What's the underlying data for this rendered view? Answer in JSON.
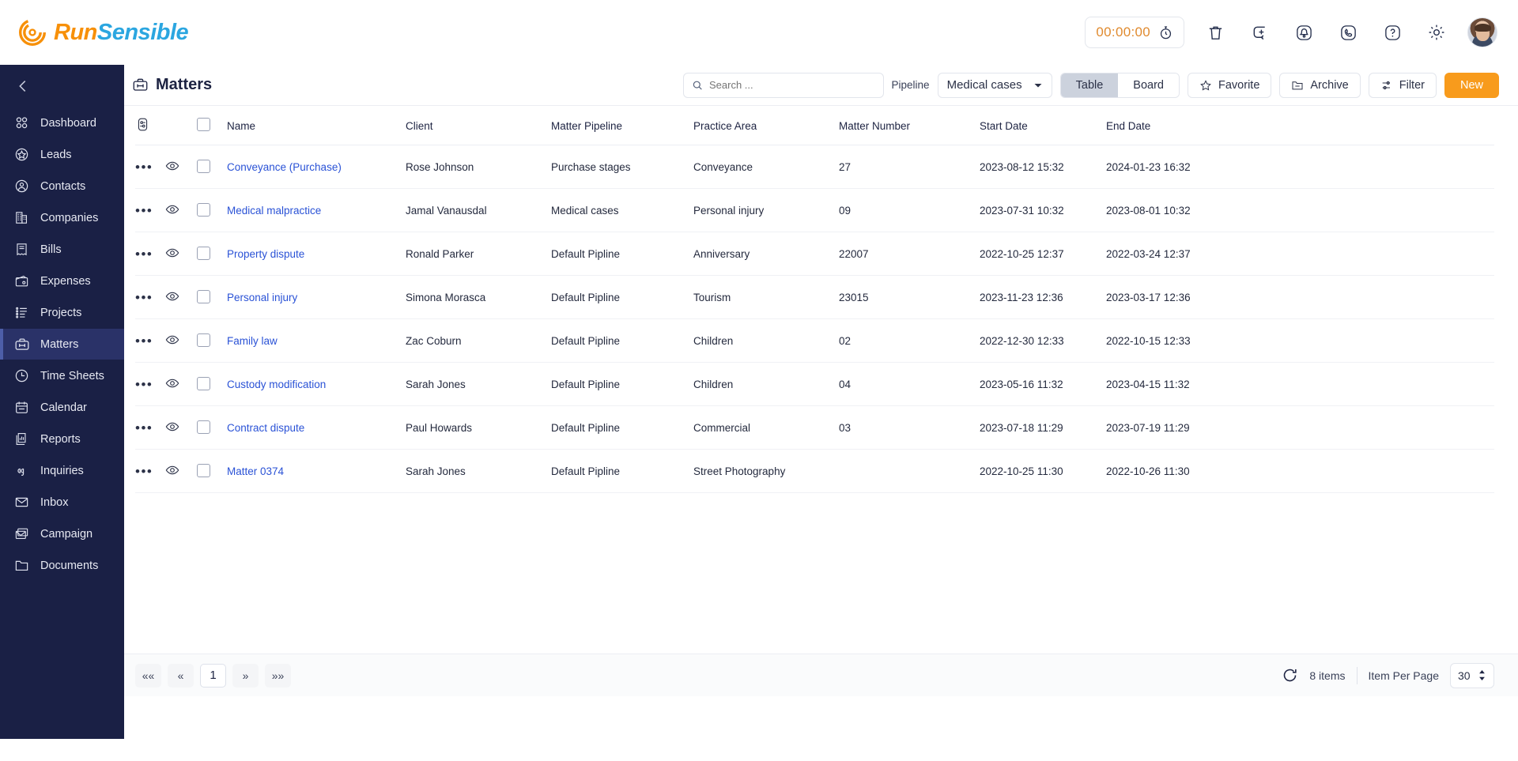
{
  "brand": {
    "run": "Run",
    "sensible": "Sensible"
  },
  "topbar": {
    "timer": "00:00:00",
    "icons": [
      "stopwatch-icon",
      "trash-icon",
      "add-note-icon",
      "bell-icon",
      "phone-icon",
      "help-icon",
      "gear-icon",
      "avatar"
    ]
  },
  "sidebar": {
    "collapse": "chevron-left-icon",
    "items": [
      {
        "label": "Dashboard",
        "icon": "dashboard-icon",
        "active": false
      },
      {
        "label": "Leads",
        "icon": "star-icon",
        "active": false
      },
      {
        "label": "Contacts",
        "icon": "user-icon",
        "active": false
      },
      {
        "label": "Companies",
        "icon": "building-icon",
        "active": false
      },
      {
        "label": "Bills",
        "icon": "receipt-icon",
        "active": false
      },
      {
        "label": "Expenses",
        "icon": "wallet-icon",
        "active": false
      },
      {
        "label": "Projects",
        "icon": "list-icon",
        "active": false
      },
      {
        "label": "Matters",
        "icon": "briefcase-icon",
        "active": true
      },
      {
        "label": "Time Sheets",
        "icon": "clock-icon",
        "active": false
      },
      {
        "label": "Calendar",
        "icon": "calendar-icon",
        "active": false
      },
      {
        "label": "Reports",
        "icon": "report-icon",
        "active": false
      },
      {
        "label": "Inquiries",
        "icon": "headset-icon",
        "active": false
      },
      {
        "label": "Inbox",
        "icon": "envelope-icon",
        "active": false
      },
      {
        "label": "Campaign",
        "icon": "campaign-icon",
        "active": false
      },
      {
        "label": "Documents",
        "icon": "folder-icon",
        "active": false
      }
    ]
  },
  "header": {
    "title": "Matters",
    "title_icon": "briefcase-icon",
    "search_placeholder": "Search ...",
    "search_value": "",
    "pipeline_label": "Pipeline",
    "pipeline_value": "Medical cases",
    "view_table": "Table",
    "view_board": "Board",
    "active_view": "Table",
    "favorite": "Favorite",
    "archive": "Archive",
    "filter": "Filter",
    "new": "New"
  },
  "table": {
    "columns": [
      "Name",
      "Client",
      "Matter Pipeline",
      "Practice Area",
      "Matter Number",
      "Start Date",
      "End Date"
    ],
    "rows": [
      {
        "name": "Conveyance (Purchase)",
        "client": "Rose Johnson",
        "pipeline": "Purchase stages",
        "area": "Conveyance",
        "number": "27",
        "start": "2023-08-12 15:32",
        "end": "2024-01-23 16:32"
      },
      {
        "name": "Medical malpractice",
        "client": "Jamal Vanausdal",
        "pipeline": "Medical cases",
        "area": "Personal injury",
        "number": "09",
        "start": "2023-07-31 10:32",
        "end": "2023-08-01 10:32"
      },
      {
        "name": "Property dispute",
        "client": "Ronald Parker",
        "pipeline": "Default Pipline",
        "area": "Anniversary",
        "number": "22007",
        "start": "2022-10-25 12:37",
        "end": "2022-03-24 12:37"
      },
      {
        "name": "Personal injury",
        "client": "Simona Morasca",
        "pipeline": "Default Pipline",
        "area": "Tourism",
        "number": "23015",
        "start": "2023-11-23 12:36",
        "end": "2023-03-17 12:36"
      },
      {
        "name": "Family law",
        "client": "Zac Coburn",
        "pipeline": "Default Pipline",
        "area": "Children",
        "number": "02",
        "start": "2022-12-30 12:33",
        "end": "2022-10-15 12:33"
      },
      {
        "name": "Custody modification",
        "client": "Sarah Jones",
        "pipeline": "Default Pipline",
        "area": "Children",
        "number": "04",
        "start": "2023-05-16 11:32",
        "end": "2023-04-15 11:32"
      },
      {
        "name": "Contract dispute",
        "client": "Paul Howards",
        "pipeline": "Default Pipline",
        "area": "Commercial",
        "number": "03",
        "start": "2023-07-18 11:29",
        "end": "2023-07-19 11:29"
      },
      {
        "name": "Matter 0374",
        "client": "Sarah Jones",
        "pipeline": "Default Pipline",
        "area": "Street Photography",
        "number": "",
        "start": "2022-10-25 11:30",
        "end": "2022-10-26 11:30"
      }
    ]
  },
  "footer": {
    "first": "««",
    "prev": "«",
    "current_page": "1",
    "next": "»",
    "last": "»»",
    "refresh_icon": "refresh-icon",
    "items_count": "8 items",
    "items_per_page_label": "Item Per Page",
    "items_per_page_value": "30"
  },
  "colors": {
    "brand_orange": "#F79009",
    "brand_blue": "#2BA6E0",
    "sidebar_bg": "#1a2045",
    "sidebar_active": "#2a3268",
    "link_blue": "#2a52d6",
    "new_button": "#F89B1C"
  }
}
